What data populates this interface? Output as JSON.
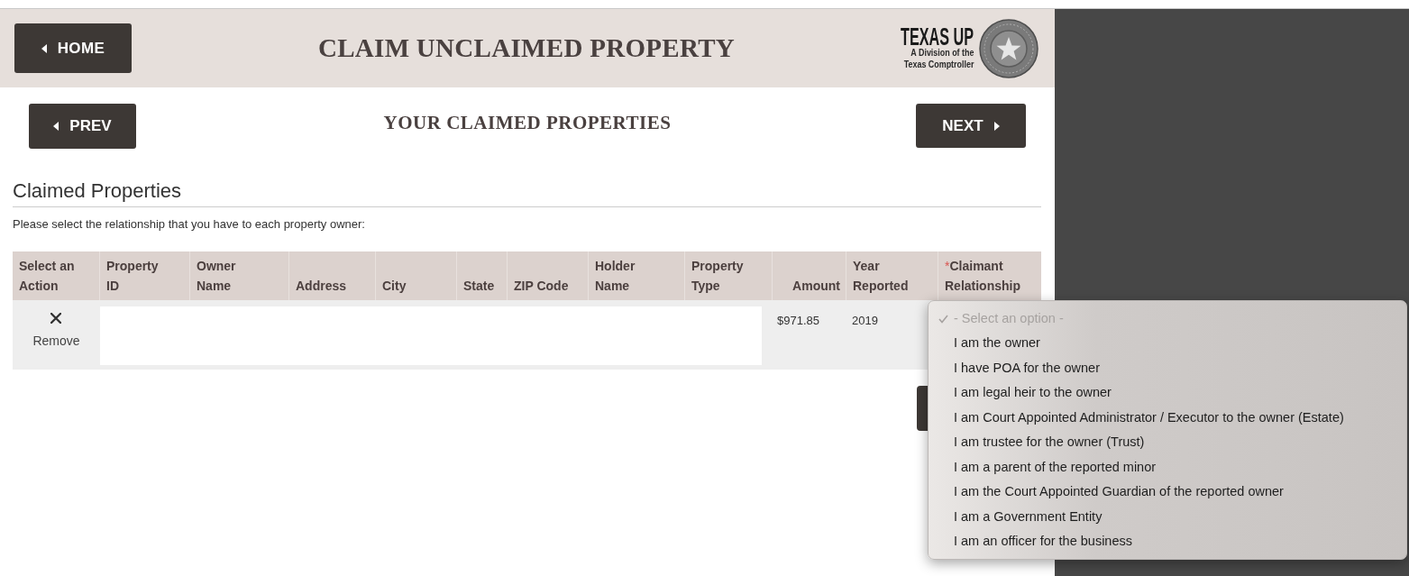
{
  "top_bar": {
    "home_button": {
      "label": "HOME"
    },
    "title": "CLAIM UNCLAIMED PROPERTY",
    "logo": {
      "wordmark": "TEXAS UP",
      "tagline_lines": [
        "A Division of the",
        "Texas Comptroller"
      ]
    }
  },
  "step_nav": {
    "prev_button": {
      "label": "PREV"
    },
    "title": "YOUR CLAIMED PROPERTIES",
    "next_button": {
      "label": "NEXT"
    }
  },
  "section": {
    "heading": "Claimed Properties",
    "instruction": "Please select the relationship that you have to each property owner:"
  },
  "table": {
    "columns": [
      {
        "label": "Select an Action"
      },
      {
        "label": "Property ID"
      },
      {
        "label": "Owner Name"
      },
      {
        "label": "Address"
      },
      {
        "label": "City"
      },
      {
        "label": "State"
      },
      {
        "label": "ZIP Code"
      },
      {
        "label": "Holder Name"
      },
      {
        "label": "Property Type"
      },
      {
        "label": "Amount"
      },
      {
        "label": "Year Reported"
      },
      {
        "label": "Claimant Relationship",
        "required_mark": "*"
      }
    ],
    "rows": [
      {
        "action": "Remove",
        "amount": "$971.85",
        "year_reported": "2019"
      }
    ]
  },
  "relationship_menu": {
    "options": [
      {
        "label": "- Select an option -",
        "selected": true,
        "disabled": true
      },
      {
        "label": "I am the owner",
        "selected": false,
        "disabled": false
      },
      {
        "label": "I have POA for the owner",
        "selected": false,
        "disabled": false
      },
      {
        "label": "I am legal heir to the owner",
        "selected": false,
        "disabled": false
      },
      {
        "label": "I am Court Appointed Administrator / Executor to the owner (Estate)",
        "selected": false,
        "disabled": false
      },
      {
        "label": "I am trustee for the owner (Trust)",
        "selected": false,
        "disabled": false
      },
      {
        "label": "I am a parent of the reported minor",
        "selected": false,
        "disabled": false
      },
      {
        "label": "I am the Court Appointed Guardian of the reported owner",
        "selected": false,
        "disabled": false
      },
      {
        "label": "I am a Government Entity",
        "selected": false,
        "disabled": false
      },
      {
        "label": "I am an officer for the business",
        "selected": false,
        "disabled": false
      }
    ]
  }
}
